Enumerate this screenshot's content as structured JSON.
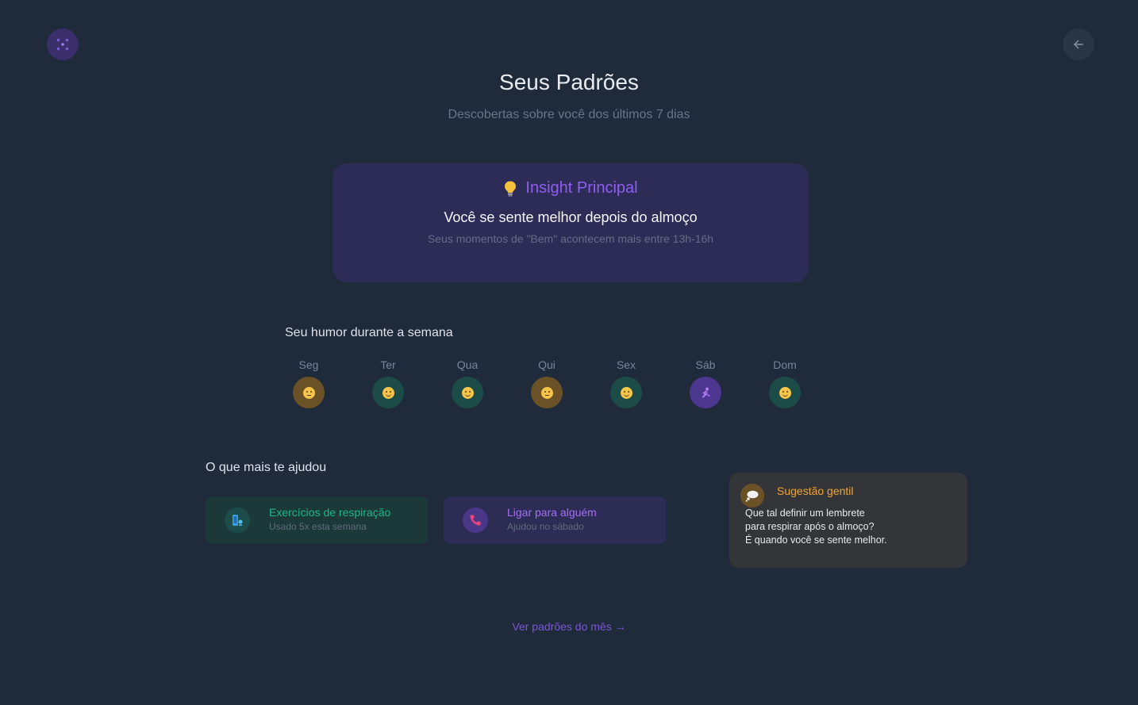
{
  "header": {
    "logo_icon": "dots-logo-icon",
    "back_icon": "arrow-left-icon"
  },
  "page": {
    "title": "Seus Padrões",
    "subtitle": "Descobertas sobre você dos últimos 7 dias"
  },
  "insight": {
    "icon": "lightbulb-icon",
    "label": "Insight Principal",
    "headline": "Você se sente melhor depois do almoço",
    "detail": "Seus momentos de \"Bem\" acontecem mais entre 13h-16h"
  },
  "week": {
    "title": "Seu humor durante a semana",
    "days": [
      {
        "label": "Seg",
        "mood": "okay"
      },
      {
        "label": "Ter",
        "mood": "good"
      },
      {
        "label": "Qua",
        "mood": "good"
      },
      {
        "label": "Qui",
        "mood": "okay"
      },
      {
        "label": "Sex",
        "mood": "good"
      },
      {
        "label": "Sáb",
        "mood": "calm"
      },
      {
        "label": "Dom",
        "mood": "good"
      }
    ]
  },
  "helped": {
    "title": "O que mais te ajudou",
    "items": [
      {
        "title": "Exercícios de respiração",
        "subtitle": "Usado 5x esta semana",
        "icon": "breathing-icon"
      },
      {
        "title": "Ligar para alguém",
        "subtitle": "Ajudou no sábado",
        "icon": "phone-icon"
      }
    ]
  },
  "suggestion": {
    "icon": "thought-bubble-icon",
    "title": "Sugestão gentil",
    "lines": [
      "Que tal definir um lembrete",
      "para respirar após o almoço?",
      "É quando você se sente melhor."
    ]
  },
  "footer": {
    "month_link": "Ver padrões do mês →"
  },
  "colors": {
    "background": "#1f2a3b",
    "accent_purple": "#8f5ef0",
    "accent_green": "#1fb58d",
    "accent_orange": "#f0a531"
  }
}
